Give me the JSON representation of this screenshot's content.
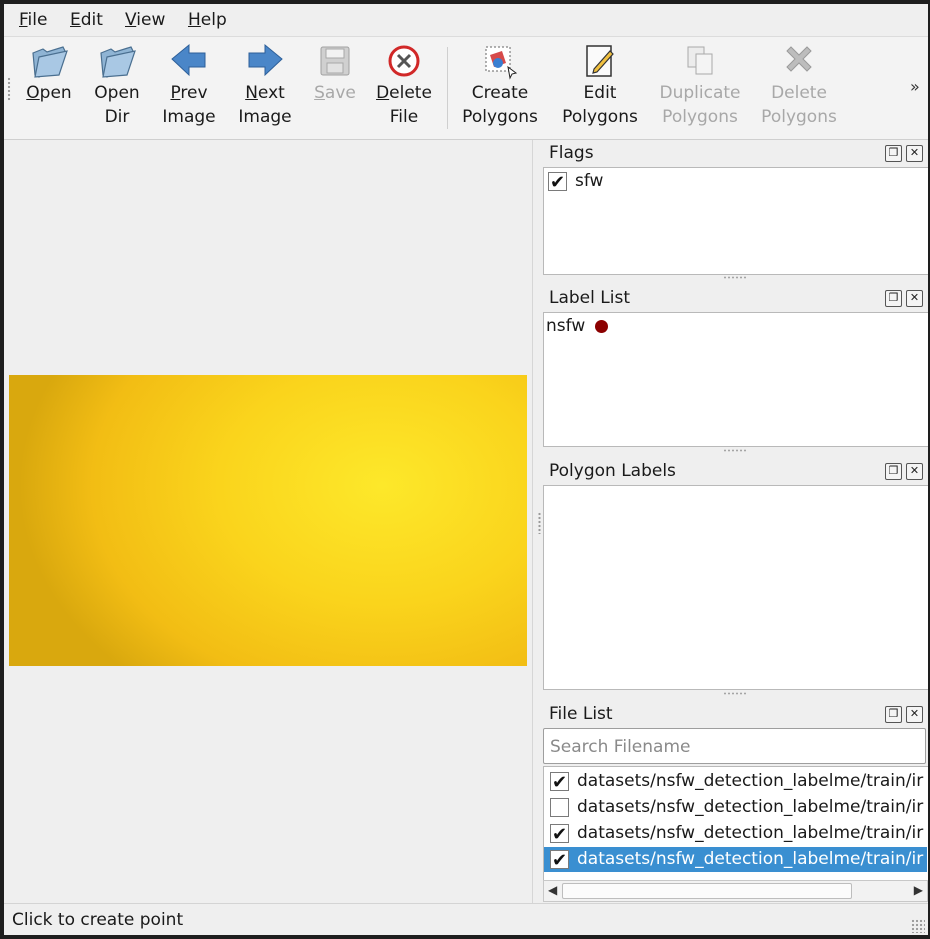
{
  "menu": [
    {
      "mnemonic": "F",
      "rest": "ile"
    },
    {
      "mnemonic": "E",
      "rest": "dit"
    },
    {
      "mnemonic": "V",
      "rest": "iew"
    },
    {
      "mnemonic": "H",
      "rest": "elp"
    }
  ],
  "toolbar": {
    "open": {
      "mnemonic": "O",
      "rest": "pen"
    },
    "open_dir": "Open\nDir",
    "prev": {
      "mnemonic": "P",
      "rest": "rev",
      "line2": "Image"
    },
    "next": {
      "mnemonic": "N",
      "rest": "ext",
      "line2": "Image"
    },
    "save": {
      "mnemonic": "S",
      "rest": "ave"
    },
    "delete_file": {
      "mnemonic": "D",
      "rest": "elete",
      "line2": "File"
    },
    "create_polygons": "Create\nPolygons",
    "edit_polygons": "Edit\nPolygons",
    "duplicate_polygons": "Duplicate\nPolygons",
    "delete_polygons": "Delete\nPolygons",
    "extension": "»"
  },
  "docks": {
    "flags": {
      "title": "Flags",
      "items": [
        {
          "label": "sfw",
          "checked": true
        }
      ]
    },
    "label_list": {
      "title": "Label List",
      "items": [
        {
          "label": "nsfw",
          "color": "#8b0000"
        }
      ]
    },
    "polygon_labels": {
      "title": "Polygon Labels",
      "items": []
    },
    "file_list": {
      "title": "File List",
      "search_placeholder": "Search Filename",
      "files": [
        {
          "name": "datasets/nsfw_detection_labelme/train/ir",
          "checked": true,
          "selected": false
        },
        {
          "name": "datasets/nsfw_detection_labelme/train/ir",
          "checked": false,
          "selected": false
        },
        {
          "name": "datasets/nsfw_detection_labelme/train/ir",
          "checked": true,
          "selected": false
        },
        {
          "name": "datasets/nsfw_detection_labelme/train/ir",
          "checked": true,
          "selected": true
        }
      ]
    },
    "restore_glyph": "❐",
    "close_glyph": "✕"
  },
  "status": {
    "text": "Click to create point"
  },
  "colors": {
    "selection": "#3a8fd1",
    "label_nsfw": "#8b0000",
    "image_yellow": "#fad41c"
  }
}
